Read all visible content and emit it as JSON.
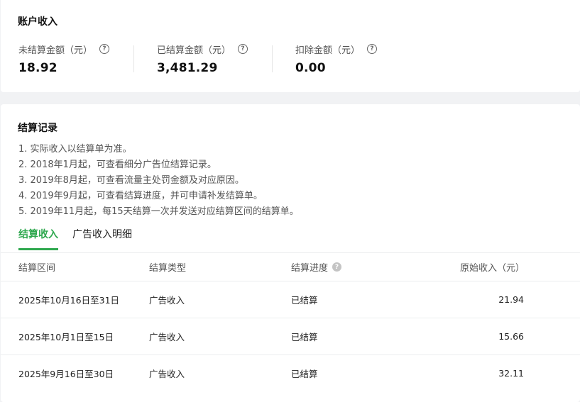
{
  "account": {
    "title": "账户收入",
    "stats": [
      {
        "label": "未结算金额（元）",
        "value": "18.92"
      },
      {
        "label": "已结算金额（元）",
        "value": "3,481.29"
      },
      {
        "label": "扣除金额（元）",
        "value": "0.00"
      }
    ]
  },
  "records": {
    "title": "结算记录",
    "notes": [
      "1. 实际收入以结算单为准。",
      "2. 2018年1月起，可查看细分广告位结算记录。",
      "3. 2019年8月起，可查看流量主处罚金额及对应原因。",
      "4. 2019年9月起，可查看结算进度，并可申请补发结算单。",
      "5. 2019年11月起，每15天结算一次并发送对应结算区间的结算单。"
    ],
    "tabs": [
      {
        "label": "结算收入",
        "active": true
      },
      {
        "label": "广告收入明细",
        "active": false
      }
    ],
    "table": {
      "headers": [
        "结算区间",
        "结算类型",
        "结算进度",
        "原始收入（元）"
      ],
      "rows": [
        [
          "2025年10月16日至31日",
          "广告收入",
          "已结算",
          "21.94"
        ],
        [
          "2025年10月1日至15日",
          "广告收入",
          "已结算",
          "15.66"
        ],
        [
          "2025年9月16日至30日",
          "广告收入",
          "已结算",
          "32.11"
        ]
      ]
    }
  },
  "colors": {
    "accent": "#2fa84f",
    "background": "#f1f2f4"
  },
  "icons": {
    "help": "question-circle-icon",
    "help_filled": "question-filled-icon"
  }
}
